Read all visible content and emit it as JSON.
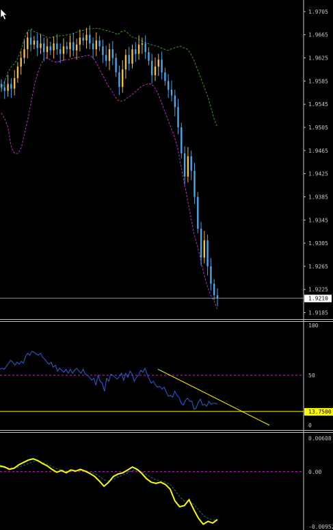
{
  "cursor_icon": "arrow-cursor-icon",
  "colors": {
    "background": "#000000",
    "separator": "#c8c8c8",
    "bull_candle": "#f0c040",
    "bear_candle": "#4aa8e8",
    "band_upper": "#3a9a20",
    "band_lower": "#c030c0",
    "price_line": "#8a8ad0",
    "rsi_line": "#3060e0",
    "level_line": "#ffff00",
    "dotted_level": "#c030c0",
    "macd_line": "#ffff00",
    "signal_line": "#208040"
  },
  "chart_data": [
    {
      "type": "line",
      "panel": "price",
      "subtype": "candlestick-with-bands",
      "title": "",
      "ylim": [
        1.9175,
        1.9725
      ],
      "y_ticks": [
        "1.9705",
        "1.9665",
        "1.9625",
        "1.9585",
        "1.9545",
        "1.9505",
        "1.9465",
        "1.9425",
        "1.9385",
        "1.9345",
        "1.9305",
        "1.9265",
        "1.9225",
        "1.9185"
      ],
      "current_price_label": "1.9210",
      "current_price": 1.921,
      "close": [
        1.9574,
        1.9568,
        1.958,
        1.9572,
        1.959,
        1.961,
        1.9625,
        1.964,
        1.966,
        1.9648,
        1.9655,
        1.9642,
        1.965,
        1.9635,
        1.9645,
        1.9638,
        1.965,
        1.964,
        1.9632,
        1.9645,
        1.964,
        1.9652,
        1.9638,
        1.9648,
        1.966,
        1.9655,
        1.9665,
        1.965,
        1.964,
        1.9655,
        1.9645,
        1.963,
        1.962,
        1.964,
        1.9625,
        1.96,
        1.9575,
        1.9605,
        1.963,
        1.9615,
        1.964,
        1.9632,
        1.9648,
        1.965,
        1.9635,
        1.962,
        1.9595,
        1.961,
        1.9622,
        1.96,
        1.9585,
        1.957,
        1.956,
        1.954,
        1.9505,
        1.946,
        1.942,
        1.9455,
        1.943,
        1.9385,
        1.933,
        1.928,
        1.931,
        1.9265,
        1.9235,
        1.9215,
        1.921
      ],
      "band_upper": [
        1.957,
        1.9585,
        1.96,
        1.961,
        1.9615,
        1.9625,
        1.964,
        1.966,
        1.9672,
        1.9675,
        1.967,
        1.9668,
        1.9665,
        1.9663,
        1.966,
        1.966,
        1.9662,
        1.9663,
        1.9663,
        1.9664,
        1.9665,
        1.9666,
        1.9668,
        1.967,
        1.9672,
        1.9673,
        1.9675,
        1.9675,
        1.9676,
        1.9676,
        1.9675,
        1.9673,
        1.9672,
        1.967,
        1.9668,
        1.9665,
        1.967,
        1.9672,
        1.9668,
        1.9662,
        1.966,
        1.9658,
        1.9655,
        1.9652,
        1.965,
        1.9648,
        1.9646,
        1.9645,
        1.9642,
        1.964,
        1.9638,
        1.964,
        1.9642,
        1.9644,
        1.9645,
        1.9642,
        1.964,
        1.9632,
        1.962,
        1.9605,
        1.959,
        1.9575,
        1.956,
        1.954,
        1.952,
        1.9505
      ],
      "band_lower": [
        1.953,
        1.952,
        1.9505,
        1.947,
        1.946,
        1.946,
        1.947,
        1.9495,
        1.952,
        1.955,
        1.958,
        1.96,
        1.9615,
        1.9625,
        1.9625,
        1.962,
        1.9618,
        1.9618,
        1.962,
        1.9622,
        1.9622,
        1.9623,
        1.9625,
        1.9626,
        1.9627,
        1.9628,
        1.963,
        1.9628,
        1.9622,
        1.9612,
        1.96,
        1.959,
        1.9578,
        1.957,
        1.956,
        1.9552,
        1.955,
        1.9552,
        1.9556,
        1.956,
        1.9565,
        1.957,
        1.9575,
        1.9578,
        1.958,
        1.958,
        1.9575,
        1.9565,
        1.955,
        1.9535,
        1.952,
        1.9505,
        1.949,
        1.947,
        1.944,
        1.941,
        1.938,
        1.935,
        1.932,
        1.93,
        1.9275,
        1.925,
        1.923,
        1.9215,
        1.9205,
        1.919
      ]
    },
    {
      "type": "line",
      "panel": "oscillator",
      "title": "",
      "ylim": [
        0,
        100
      ],
      "y_ticks": [
        "100",
        "50",
        "0"
      ],
      "level_label": "13.7500",
      "level_value": 13.75,
      "dotted_level": 50,
      "series": [
        {
          "values": [
            56,
            57,
            56,
            59,
            62,
            65,
            63,
            60,
            63,
            61,
            64,
            62,
            69,
            72,
            70,
            74,
            73,
            71,
            70,
            72,
            68,
            66,
            63,
            61,
            63,
            58,
            60,
            54,
            57,
            55,
            53,
            56,
            52,
            56,
            52,
            55,
            57,
            54,
            52,
            56,
            51,
            50,
            48,
            45,
            47,
            40,
            50,
            44,
            42,
            34,
            47,
            44,
            51,
            50,
            48,
            46,
            49,
            52,
            45,
            52,
            48,
            54,
            51,
            44,
            48,
            50,
            55,
            53,
            57,
            51,
            46,
            42,
            44,
            40,
            38,
            39,
            36,
            38,
            33,
            29,
            30,
            28,
            34,
            30,
            28,
            22,
            20,
            25,
            27,
            24,
            24,
            16,
            17,
            23,
            26,
            20,
            21,
            19,
            24,
            21,
            22,
            22,
            21
          ]
        }
      ],
      "trendline": [
        [
          231,
          56
        ],
        [
          394,
          0
        ]
      ]
    },
    {
      "type": "line",
      "panel": "macd",
      "title": "",
      "ylim": [
        -0.00952,
        0.00608
      ],
      "y_ticks": [
        "0.00608",
        "0.00",
        "-0.00952"
      ],
      "dotted_level": 0,
      "series": [
        {
          "values": [
            0.001,
            0.0008,
            0.0004,
            0.0006,
            0.0012,
            0.0016,
            0.002,
            0.0022,
            0.0019,
            0.0014,
            0.001,
            0.0004,
            -0.0001,
            0.0002,
            -0.0002,
            0.0003,
            0.0001,
            0.0004,
            0.0001,
            -0.0003,
            -0.0008,
            -0.0016,
            -0.0025,
            -0.0018,
            -0.0008,
            -0.0004,
            -0.0002,
            0.0003,
            0.0008,
            0.0004,
            -0.0003,
            -0.0012,
            -0.0018,
            -0.002,
            -0.0018,
            -0.0022,
            -0.003,
            -0.005,
            -0.006,
            -0.0058,
            -0.0048,
            -0.0065,
            -0.008,
            -0.009,
            -0.0085,
            -0.0088,
            -0.0082
          ]
        },
        {
          "values": [
            0.0008,
            0.0007,
            0.0006,
            0.0006,
            0.0008,
            0.0011,
            0.0014,
            0.0017,
            0.0018,
            0.0016,
            0.0013,
            0.0009,
            0.0005,
            0.0003,
            0.0001,
            0.0001,
            0.0001,
            0.0002,
            0.0002,
            0.0,
            -0.0003,
            -0.0008,
            -0.0014,
            -0.0016,
            -0.0013,
            -0.0009,
            -0.0006,
            -0.0002,
            0.0002,
            0.0003,
            0.0,
            -0.0005,
            -0.001,
            -0.0014,
            -0.0016,
            -0.0018,
            -0.0022,
            -0.0032,
            -0.0043,
            -0.005,
            -0.005,
            -0.0056,
            -0.0065,
            -0.0075,
            -0.008,
            -0.0083,
            -0.0083
          ]
        }
      ]
    }
  ]
}
